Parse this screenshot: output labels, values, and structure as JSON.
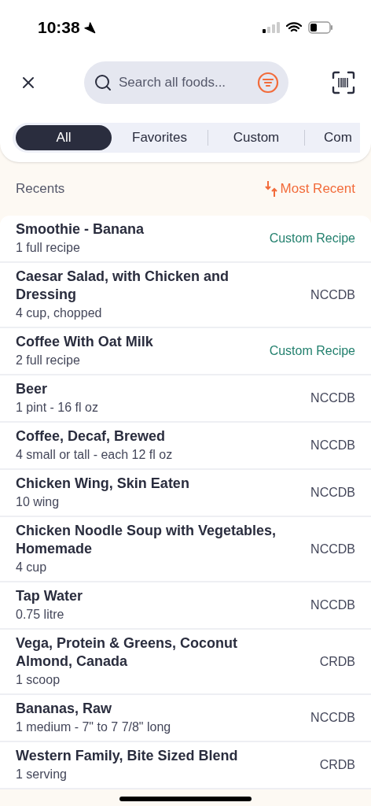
{
  "status_bar": {
    "time": "10:38"
  },
  "search": {
    "placeholder": "Search all foods..."
  },
  "tabs": [
    {
      "label": "All",
      "selected": true
    },
    {
      "label": "Favorites",
      "selected": false
    },
    {
      "label": "Custom",
      "selected": false
    },
    {
      "label": "Com",
      "selected": false
    }
  ],
  "section": {
    "title": "Recents",
    "sort": "Most Recent"
  },
  "foods": [
    {
      "name": "Smoothie - Banana",
      "serving": "1 full recipe",
      "source": "Custom Recipe",
      "kind": "custom"
    },
    {
      "name": "Caesar Salad, with Chicken and Dressing",
      "serving": "4 cup, chopped",
      "source": "NCCDB",
      "kind": "database"
    },
    {
      "name": "Coffee With Oat Milk",
      "serving": "2 full recipe",
      "source": "Custom Recipe",
      "kind": "custom"
    },
    {
      "name": "Beer",
      "serving": "1 pint - 16 fl oz",
      "source": "NCCDB",
      "kind": "database"
    },
    {
      "name": "Coffee, Decaf, Brewed",
      "serving": "4 small or tall - each 12 fl oz",
      "source": "NCCDB",
      "kind": "database"
    },
    {
      "name": "Chicken Wing, Skin Eaten",
      "serving": "10 wing",
      "source": "NCCDB",
      "kind": "database"
    },
    {
      "name": "Chicken Noodle Soup with Vegetables, Homemade",
      "serving": "4 cup",
      "source": "NCCDB",
      "kind": "database"
    },
    {
      "name": "Tap Water",
      "serving": "0.75 litre",
      "source": "NCCDB",
      "kind": "database"
    },
    {
      "name": "Vega, Protein & Greens, Coconut Almond, Canada",
      "serving": "1 scoop",
      "source": "CRDB",
      "kind": "database"
    },
    {
      "name": "Bananas, Raw",
      "serving": "1 medium - 7\" to 7 7/8\" long",
      "source": "NCCDB",
      "kind": "database"
    },
    {
      "name": "Western Family, Bite Sized Blend",
      "serving": "1 serving",
      "source": "CRDB",
      "kind": "database"
    }
  ]
}
